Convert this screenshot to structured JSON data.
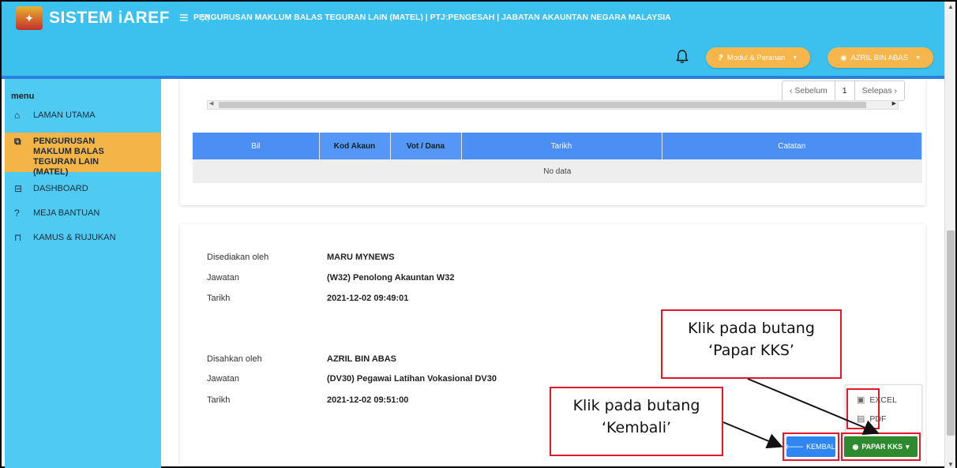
{
  "header": {
    "app_name": "SISTEM iAREF",
    "page_heading": "PENGURUSAN MAKLUM BALAS TEGURAN LAIN (MATEL) | PTJ:PENGESAH | JABATAN AKAUNTAN NEGARA MALAYSIA",
    "module_label": "Modul & Peranan",
    "user_label": "AZRIL BIN ABAS"
  },
  "sidebar": {
    "title": "menu",
    "items": [
      {
        "label": "LAMAN UTAMA"
      },
      {
        "label": "PENGURUSAN MAKLUM BALAS TEGURAN LAIN (MATEL)"
      },
      {
        "label": "DASHBOARD"
      },
      {
        "label": "MEJA BANTUAN"
      },
      {
        "label": "KAMUS & RUJUKAN"
      }
    ]
  },
  "pager": {
    "prev": "‹ Sebelum",
    "page": "1",
    "next": "Selepas ›"
  },
  "table": {
    "columns": [
      "Bil",
      "Kod Akaun",
      "Vot / Dana",
      "Tarikh",
      "Catatan"
    ],
    "empty_text": "No data"
  },
  "prepared": {
    "label_by": "Disediakan oleh",
    "by": "MARU MYNEWS",
    "label_position": "Jawatan",
    "position": "(W32) Penolong Akauntan W32",
    "label_date": "Tarikh",
    "date": "2021-12-02 09:49:01"
  },
  "approved": {
    "label_by": "Disahkan oleh",
    "by": "AZRIL BIN ABAS",
    "label_position": "Jawatan",
    "position": "(DV30) Pegawai Latihan Vokasional DV30",
    "label_date": "Tarikh",
    "date": "2021-12-02 09:51:00"
  },
  "callouts": {
    "papar_line1": "Klik pada butang",
    "papar_line2": "‘Papar KKS’",
    "kembali_line1": "Klik pada butang",
    "kembali_line2": "‘Kembali’"
  },
  "export_menu": {
    "excel": "EXCEL",
    "pdf": "PDF"
  },
  "buttons": {
    "kembali": "KEMBALI",
    "papar": "PAPAR KKS"
  },
  "colors": {
    "topbar": "#3cc1ee",
    "sidebar": "#4fcaf0",
    "accent": "#f4b548",
    "highlight": "#e2182b",
    "primary": "#2f86f2",
    "success": "#2e8a2e"
  }
}
